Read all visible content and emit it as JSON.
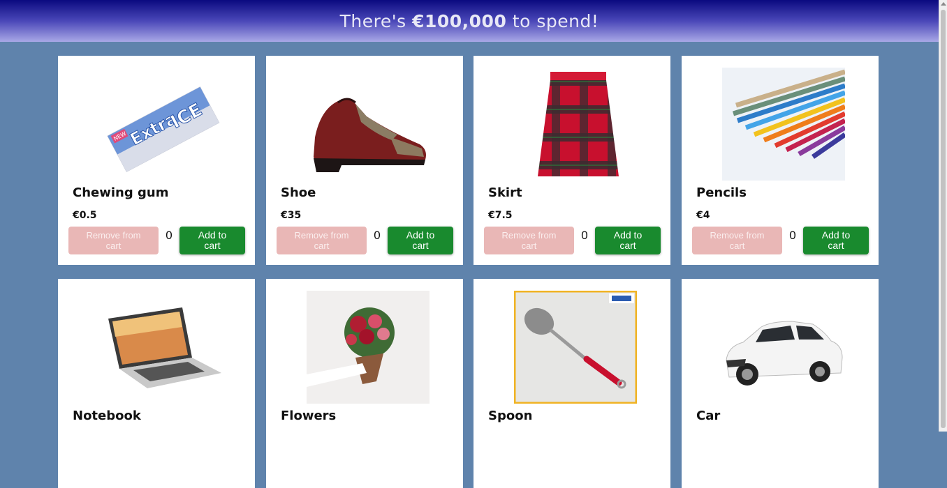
{
  "header": {
    "prefix": "There's ",
    "amount": "€100,000",
    "suffix": " to spend!"
  },
  "labels": {
    "remove": "Remove from cart",
    "add": "Add to cart"
  },
  "products": [
    {
      "name": "Chewing gum",
      "price": "€0.5",
      "qty": "0",
      "image": "chewing-gum-image"
    },
    {
      "name": "Shoe",
      "price": "€35",
      "qty": "0",
      "image": "shoe-image"
    },
    {
      "name": "Skirt",
      "price": "€7.5",
      "qty": "0",
      "image": "skirt-image"
    },
    {
      "name": "Pencils",
      "price": "€4",
      "qty": "0",
      "image": "pencils-image"
    },
    {
      "name": "Notebook",
      "image": "notebook-image"
    },
    {
      "name": "Flowers",
      "image": "flowers-image"
    },
    {
      "name": "Spoon",
      "image": "spoon-image"
    },
    {
      "name": "Car",
      "image": "car-image"
    }
  ],
  "colors": {
    "background": "#5f83ac",
    "remove_button": "#e9b7b6",
    "add_button": "#198a2e"
  }
}
